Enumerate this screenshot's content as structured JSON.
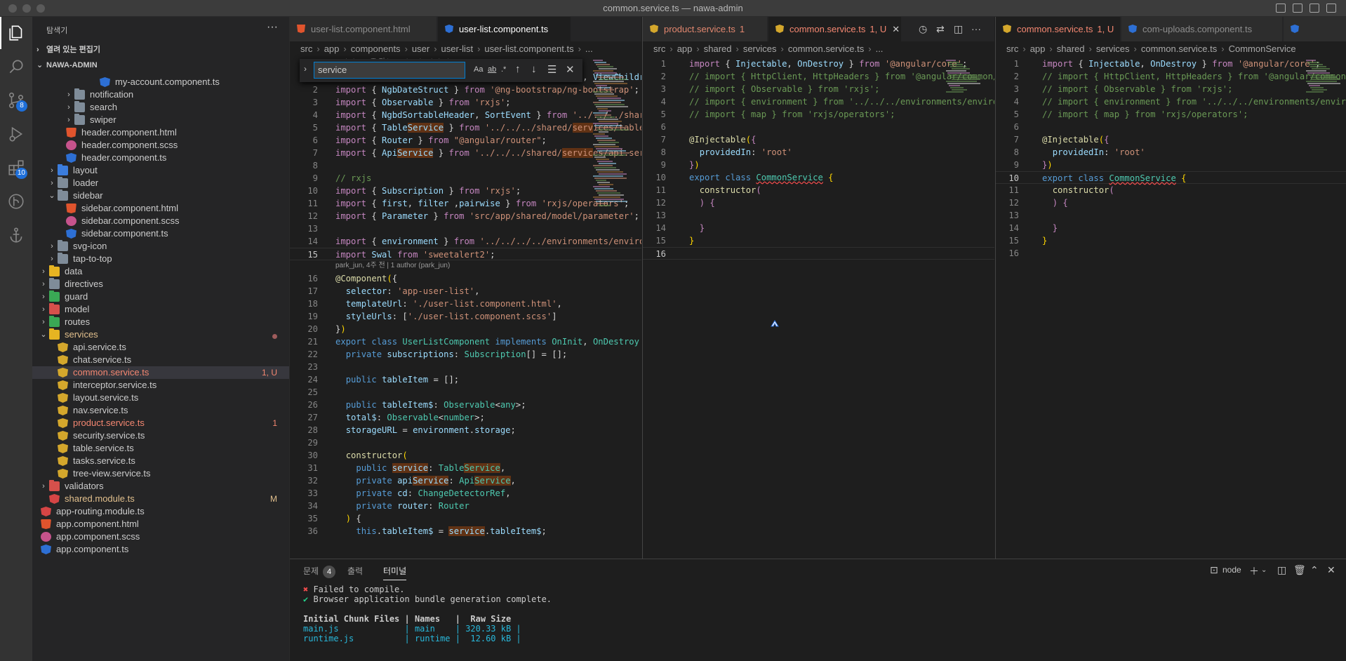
{
  "window": {
    "title": "common.service.ts — nawa-admin"
  },
  "activity_bar": {
    "scm_badge": "8",
    "extensions_badge": "10"
  },
  "sidebar": {
    "title": "탐색기",
    "open_editors_label": "열려 있는 편집기",
    "workspace_label": "NAWA-ADMIN",
    "tree": [
      {
        "name": "my-account.component.ts",
        "type": "ang"
      },
      {
        "name": "notification",
        "type": "folder"
      },
      {
        "name": "search",
        "type": "folder"
      },
      {
        "name": "swiper",
        "type": "folder"
      },
      {
        "name": "header.component.html",
        "type": "html"
      },
      {
        "name": "header.component.scss",
        "type": "scss"
      },
      {
        "name": "header.component.ts",
        "type": "ang"
      },
      {
        "name": "layout",
        "type": "folder"
      },
      {
        "name": "loader",
        "type": "folder"
      },
      {
        "name": "sidebar",
        "type": "folder-open"
      },
      {
        "name": "sidebar.component.html",
        "type": "html"
      },
      {
        "name": "sidebar.component.scss",
        "type": "scss"
      },
      {
        "name": "sidebar.component.ts",
        "type": "ang"
      },
      {
        "name": "svg-icon",
        "type": "folder"
      },
      {
        "name": "tap-to-top",
        "type": "folder"
      },
      {
        "name": "data",
        "type": "folder"
      },
      {
        "name": "directives",
        "type": "folder"
      },
      {
        "name": "guard",
        "type": "folder"
      },
      {
        "name": "model",
        "type": "folder"
      },
      {
        "name": "routes",
        "type": "folder"
      },
      {
        "name": "services",
        "type": "folder-open"
      },
      {
        "name": "api.service.ts",
        "type": "ang-y"
      },
      {
        "name": "chat.service.ts",
        "type": "ang-y"
      },
      {
        "name": "common.service.ts",
        "type": "ang-y",
        "badge": "1, U"
      },
      {
        "name": "interceptor.service.ts",
        "type": "ang-y"
      },
      {
        "name": "layout.service.ts",
        "type": "ang-y"
      },
      {
        "name": "nav.service.ts",
        "type": "ang-y"
      },
      {
        "name": "product.service.ts",
        "type": "ang-y",
        "badge": "1"
      },
      {
        "name": "security.service.ts",
        "type": "ang-y"
      },
      {
        "name": "table.service.ts",
        "type": "ang-y"
      },
      {
        "name": "tasks.service.ts",
        "type": "ang-y"
      },
      {
        "name": "tree-view.service.ts",
        "type": "ang-y"
      },
      {
        "name": "validators",
        "type": "folder"
      },
      {
        "name": "shared.module.ts",
        "type": "ang-r",
        "badge": "M"
      },
      {
        "name": "app-routing.module.ts",
        "type": "ang-r"
      },
      {
        "name": "app.component.html",
        "type": "html"
      },
      {
        "name": "app.component.scss",
        "type": "scss"
      },
      {
        "name": "app.component.ts",
        "type": "ang"
      }
    ]
  },
  "group1": {
    "tabs": [
      {
        "label": "user-list.component.html"
      },
      {
        "label": "user-list.component.ts"
      }
    ],
    "breadcrumb": [
      "src",
      "app",
      "components",
      "user",
      "user-list",
      "user-list.component.ts",
      "..."
    ],
    "find": {
      "value": "service",
      "opt_case": "Aa",
      "opt_word": "ab",
      "opt_regex": ".*"
    },
    "blame1": "park_jun, 4주 전 | 1 author (park_jun)",
    "blame2": "park_jun, 4주 전 | 1 author (park_jun)"
  },
  "group2": {
    "tabs": [
      {
        "label": "product.service.ts",
        "status": "1"
      },
      {
        "label": "common.service.ts",
        "status": "1, U"
      }
    ],
    "breadcrumb": [
      "src",
      "app",
      "shared",
      "services",
      "common.service.ts",
      "..."
    ]
  },
  "group3": {
    "tabs": [
      {
        "label": "common.service.ts",
        "status": "1, U"
      },
      {
        "label": "com-uploads.component.ts"
      }
    ],
    "breadcrumb": [
      "src",
      "app",
      "shared",
      "services",
      "common.service.ts",
      "CommonService"
    ]
  },
  "panel": {
    "tabs": [
      {
        "label": "문제",
        "count": "4"
      },
      {
        "label": "출력"
      },
      {
        "label": "터미널"
      }
    ],
    "shell": "node",
    "terminal": [
      "✖ Failed to compile.",
      "✔ Browser application bundle generation complete.",
      "",
      "Initial Chunk Files | Names   |  Raw Size",
      "main.js             | main    | 320.33 kB |",
      "runtime.js          | runtime |  12.60 kB |"
    ]
  },
  "colors": {
    "accent": "#007acc",
    "modified": "#e2c08d",
    "error": "#f48771",
    "keyword": "#569cd6",
    "string": "#ce9178",
    "type": "#4ec9b0",
    "comment": "#6a9955"
  }
}
